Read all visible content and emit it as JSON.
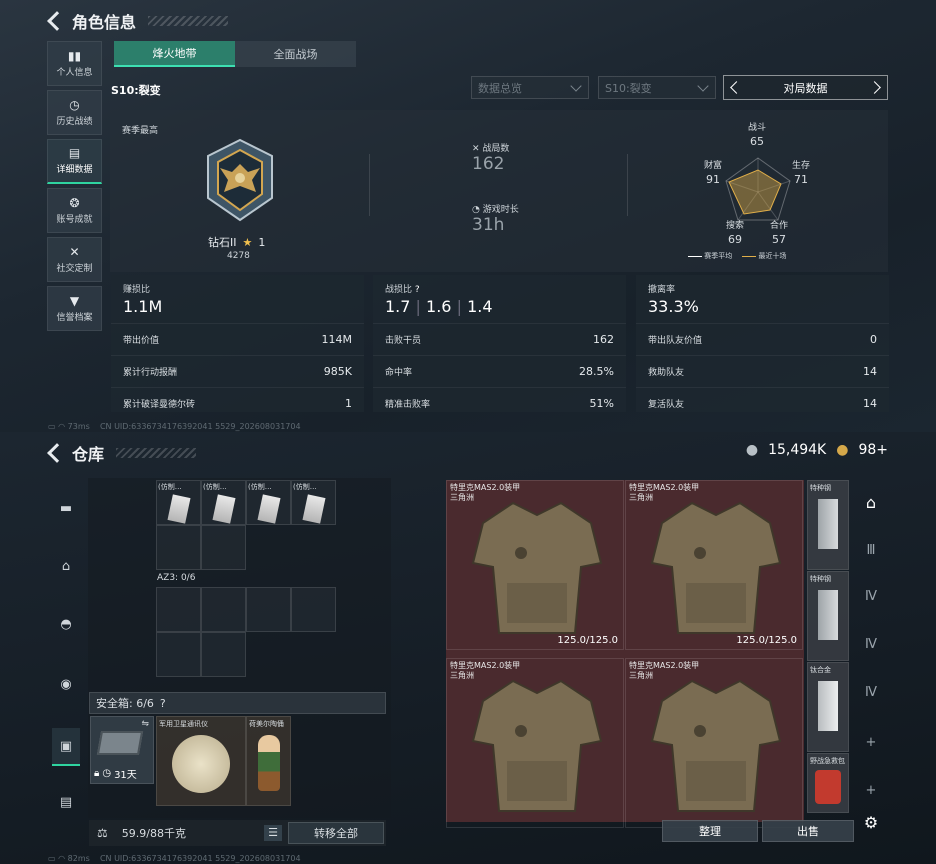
{
  "top": {
    "title": "角色信息",
    "nav": [
      {
        "label": "个人信息",
        "icon": "bar-chart-icon"
      },
      {
        "label": "历史战绩",
        "icon": "history-icon"
      },
      {
        "label": "详细数据",
        "icon": "folder-icon"
      },
      {
        "label": "账号成就",
        "icon": "medal-icon"
      },
      {
        "label": "社交定制",
        "icon": "tools-icon"
      },
      {
        "label": "信誉档案",
        "icon": "shield-v-icon"
      }
    ],
    "tabs": [
      "烽火地带",
      "全面战场"
    ],
    "season": "S10:裂变",
    "dropdowns": [
      "数据总览",
      "S10:裂变"
    ],
    "data_box": "对局数据",
    "season_best_label": "赛季最高",
    "rank_name": "钻石II",
    "rank_stars": "1",
    "rank_points": "4278",
    "matches_label": "战局数",
    "matches_value": "162",
    "playtime_label": "游戏时长",
    "playtime_value": "31h",
    "radar": {
      "labels": {
        "combat": "战斗",
        "survival": "生存",
        "teamwork": "合作",
        "search": "搜索",
        "wealth": "财富"
      },
      "values": {
        "combat": "65",
        "survival": "71",
        "teamwork": "57",
        "search": "69",
        "wealth": "91"
      },
      "legend_avg": "赛季平均",
      "legend_recent": "最近十场"
    },
    "cards": [
      {
        "head_label": "赚损比",
        "head_value": "1.1M",
        "rows": [
          [
            "带出价值",
            "114M"
          ],
          [
            "累计行动报酬",
            "985K"
          ],
          [
            "累计破译曼德尔砖",
            "1"
          ]
        ]
      },
      {
        "head_label": "战损比",
        "head_values": [
          "1.7",
          "1.6",
          "1.4"
        ],
        "help": "?",
        "rows": [
          [
            "击败干员",
            "162"
          ],
          [
            "命中率",
            "28.5%"
          ],
          [
            "精准击败率",
            "51%"
          ]
        ]
      },
      {
        "head_label": "撤离率",
        "head_value": "33.3%",
        "rows": [
          [
            "带出队友价值",
            "0"
          ],
          [
            "救助队友",
            "14"
          ],
          [
            "复活队友",
            "14"
          ]
        ]
      }
    ],
    "footer_ping": "73ms",
    "footer_uid": "CN UID:6336734176392041 5529_202608031704"
  },
  "bottom": {
    "title": "仓库",
    "currency_silver": "15,494K",
    "currency_gold": "98+",
    "mini_item_label": "(仿制…",
    "az_label": "AZ3: 0/6",
    "safe_box_label": "安全箱: 6/6",
    "safe_box_help": "?",
    "safe_items": [
      {
        "name": "",
        "timer": "31天"
      },
      {
        "name": "军用卫星通讯仪"
      },
      {
        "name": "荷美尔陶俑"
      }
    ],
    "weight": "59.9/88千克",
    "transfer_all": "转移全部",
    "vests": [
      {
        "name": "特里克MAS2.0装甲",
        "sub": "三角洲",
        "durability": "125.0/125.0"
      },
      {
        "name": "特里克MAS2.0装甲",
        "sub": "三角洲",
        "durability": "125.0/125.0"
      },
      {
        "name": "特里克MAS2.0装甲",
        "sub": "三角洲",
        "durability": ""
      },
      {
        "name": "特里克MAS2.0装甲",
        "sub": "三角洲",
        "durability": ""
      }
    ],
    "plates": [
      "特种钢",
      "特种钢",
      "钛合金",
      "野战急救包"
    ],
    "organize_button": "整理",
    "sell_button": "出售",
    "footer_ping": "82ms",
    "footer_uid": "CN UID:6336734176392041 5529_202608031704"
  }
}
